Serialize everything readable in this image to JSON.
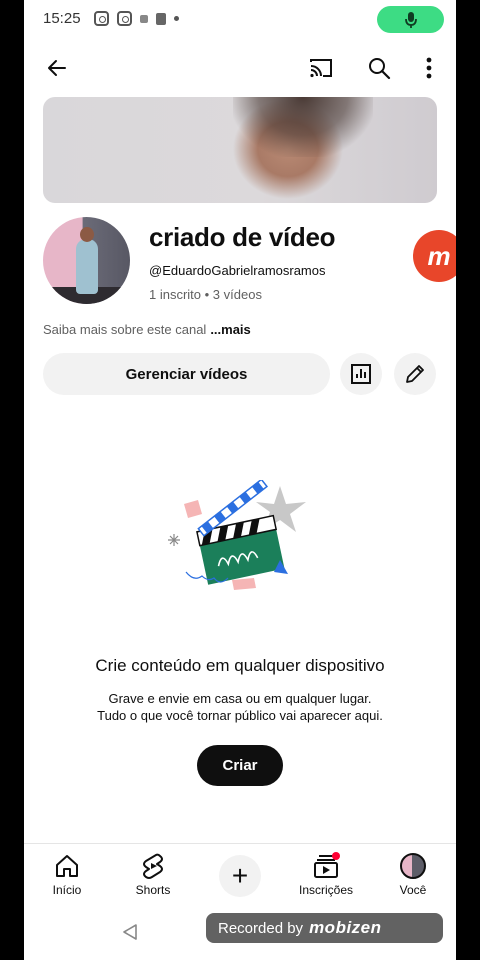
{
  "status_bar": {
    "time": "15:25"
  },
  "top_bar": {
    "back_icon": "arrow-left-icon",
    "cast_icon": "cast-icon",
    "search_icon": "search-icon",
    "more_icon": "more-vertical-icon"
  },
  "channel": {
    "name": "criado de vídeo",
    "handle": "@EduardoGabrielramosramos",
    "stats": "1 inscrito • 3 vídeos",
    "about": "Saiba mais sobre este canal",
    "about_more": "...mais"
  },
  "actions": {
    "manage_label": "Gerenciar vídeos",
    "analytics_icon": "analytics-icon",
    "edit_icon": "pencil-icon"
  },
  "empty_state": {
    "title": "Crie conteúdo em qualquer dispositivo",
    "line1": "Grave e envie em casa ou em qualquer lugar.",
    "line2": "Tudo o que você tornar público vai aparecer aqui.",
    "button": "Criar"
  },
  "bottom_nav": {
    "home": "Início",
    "shorts": "Shorts",
    "create": "+",
    "subscriptions": "Inscrições",
    "you": "Você"
  },
  "overlay": {
    "badge_letter": "m",
    "recorded_by": "Recorded by",
    "brand": "mobizen"
  },
  "colors": {
    "mic_pill": "#3ddc84",
    "badge": "#e8462a",
    "notification_dot": "#ff0033",
    "button_dark": "#0f0f0f",
    "chip_bg": "#f2f2f2"
  }
}
